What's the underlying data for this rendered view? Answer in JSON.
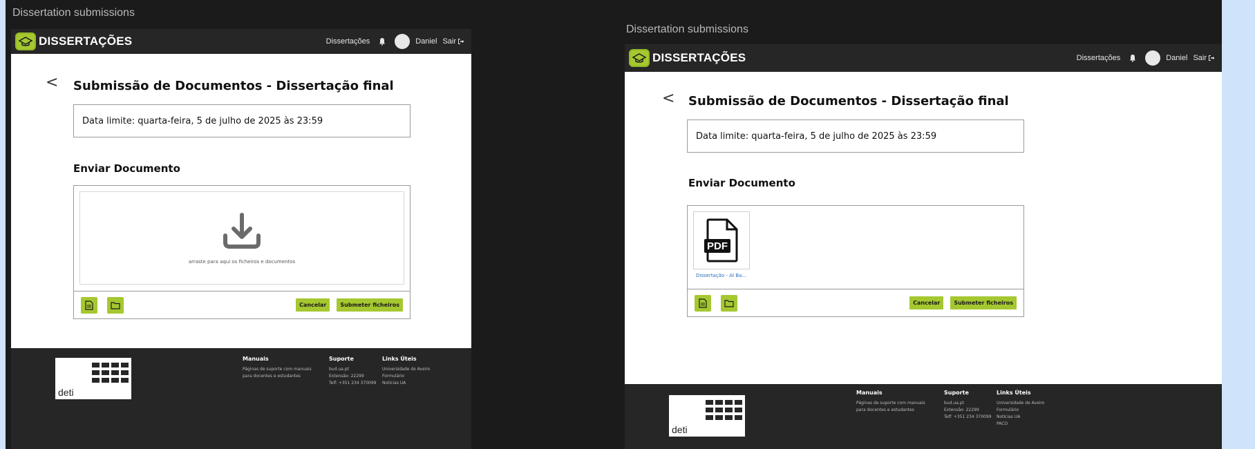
{
  "window_title": "Dissertation submissions",
  "navbar": {
    "brand": "DISSERTAÇÕES",
    "nav_link": "Dissertações",
    "user_name": "Daniel",
    "logout_label": "Sair"
  },
  "page": {
    "back_symbol": "<",
    "title": "Submissão de Documentos - Dissertação final",
    "deadline": "Data limite: quarta-feira, 5 de julho de 2025 às 23:59",
    "section_title": "Enviar Documento"
  },
  "upload": {
    "dropzone_hint": "arraste para aqui os ficheiros e documentos",
    "cancel_label": "Cancelar",
    "submit_label": "Submeter ficheiros",
    "file_name": "Dissertação - AI Ba...",
    "file_type": "PDF"
  },
  "footer": {
    "logo_text": "deti",
    "manuals": {
      "heading": "Manuais",
      "lines": [
        "Páginas de suporte com manuais",
        "para docentes e estudantes"
      ]
    },
    "support": {
      "heading": "Suporte",
      "lines_left": [
        "bud.ua.pt",
        "Extensão: 22299",
        "Telf: +351 234 370099"
      ],
      "lines_right": [
        "bud.ua.pt",
        "Extensão: 22299",
        "Telf: +351 234 370099"
      ]
    },
    "links": {
      "heading": "Links Úteis",
      "lines_left": [
        "Universidade de Aveiro",
        "Formulário",
        "Notícias UA"
      ],
      "lines_right": [
        "Universidade de Aveiro",
        "Formulário",
        "Notícias UA",
        "PACO"
      ]
    }
  },
  "colors": {
    "accent": "#a5c830",
    "navbar": "#262626",
    "background": "#1b1b1b"
  }
}
